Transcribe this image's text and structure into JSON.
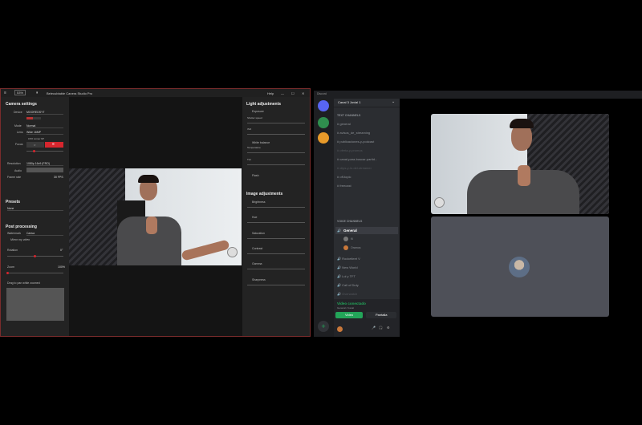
{
  "camera_app": {
    "zoom": "53%",
    "title": "Belecubtable Canera Studio Pro",
    "help": "Help",
    "camera_settings": {
      "title": "Camera settings",
      "device_label": "Device",
      "device_value": "MOOREDSYT",
      "mode_label": "Mode",
      "mode_value": "Normal",
      "lens_label": "Lens",
      "lens_value": "Wide 16MP",
      "lens_sub": "0.5X Linner 6P",
      "focus_label": "Focus",
      "resolution_label": "Resolution",
      "resolution_value": "1080p 16x9 (FRO)",
      "audio_label": "Audio",
      "frame_rate_label": "Frame rate",
      "frame_rate_value": "30 FPS"
    },
    "presets": {
      "title": "Presets",
      "value": "None"
    },
    "post_processing": {
      "title": "Post processing",
      "watermark_label": "Watermark",
      "watermark_value": "Canva",
      "mirror_label": "Mirror my video",
      "rotation_label": "Rotation",
      "rotation_value": "0°",
      "zoom_label": "Zoom",
      "zoom_value": "100%",
      "drag_label": "Drag to pan while zoomed"
    },
    "light_adjustments": {
      "title": "Light adjustments",
      "items": [
        "Exposure",
        "Shutter speed",
        "ISO",
        "White balance",
        "Temperature",
        "Tint",
        "Flash"
      ]
    },
    "image_adjustments": {
      "title": "Image adjustments",
      "items": [
        "Brightness",
        "Hue",
        "Saturation",
        "Contrast",
        "Gamma",
        "Sharpness"
      ]
    }
  },
  "chat_app": {
    "title": "Discord",
    "server_name": "Canal 3 Jovial 1",
    "text_header": "TEXT CHANNELS",
    "text_channels": [
      "general",
      "avisos_de_streaming",
      "publicaciones-y-podcast",
      "oferta-y-promos",
      "canal-para-buscar-partid...",
      "clips-y-lo-del-streamer",
      "off-topic",
      "freecast"
    ],
    "voice_header": "VOICE CHANNELS",
    "voice_channels": [
      "General",
      "Rocketleet V",
      "New World",
      "Lol y TFT",
      "Call of Duty",
      "Overwatch"
    ],
    "voice_users": [
      "Ki",
      "Oramos"
    ],
    "voice_status": "Video conectado",
    "voice_sub": "General / Canal",
    "video_button": "Video",
    "screen_button": "Pantalla"
  },
  "colors": {
    "accent_red": "#d6262e",
    "discord_green": "#23a559",
    "discord_blurple": "#5865f2"
  },
  "icons": [
    "hamburger-icon",
    "pause-icon",
    "minimize-icon",
    "maximize-icon",
    "close-icon",
    "discord-logo-icon",
    "plus-icon",
    "microphone-icon",
    "headphones-icon",
    "gear-icon",
    "speaker-icon",
    "hash-icon"
  ]
}
